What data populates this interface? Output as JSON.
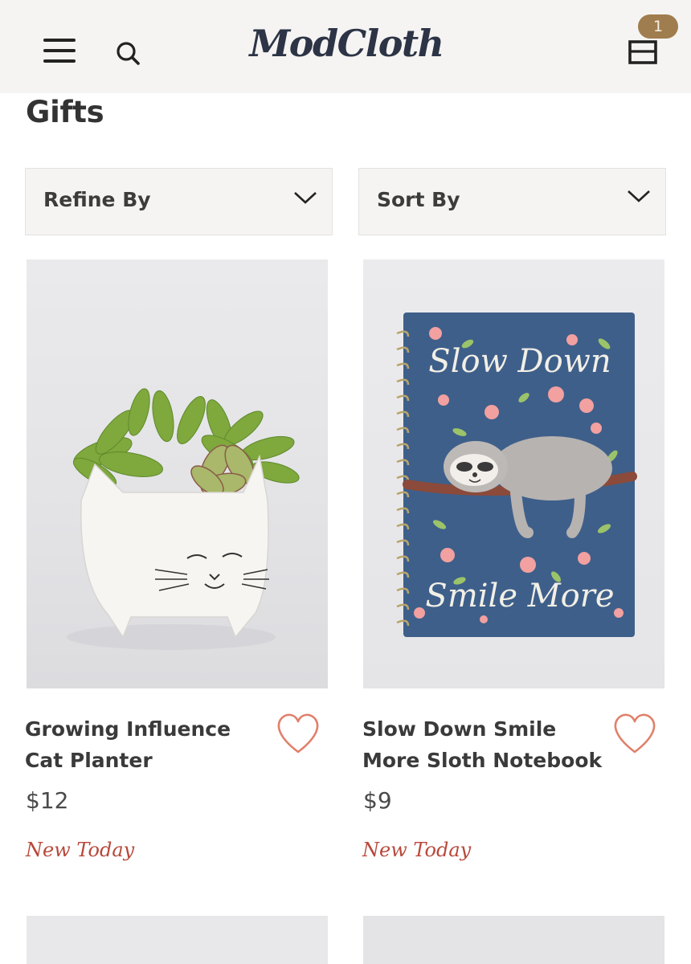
{
  "header": {
    "logo": "ModCloth",
    "cart_count": "1",
    "icons": {
      "menu": "hamburger-menu-icon",
      "search": "search-icon",
      "cart": "shopping-bag-icon"
    }
  },
  "page": {
    "title": "Gifts"
  },
  "filters": {
    "refine_label": "Refine By",
    "sort_label": "Sort By"
  },
  "products": [
    {
      "title": "Growing Influence Cat Planter",
      "price": "$12",
      "badge": "New Today",
      "image": "white cat planter with succulents"
    },
    {
      "title": "Slow Down Smile More Sloth Notebook",
      "price": "$9",
      "badge": "New Today",
      "image": "blue spiral notebook with sloth",
      "cover_text": [
        "Slow Down",
        "Smile More"
      ]
    }
  ],
  "colors": {
    "header_bg": "#f5f4f2",
    "logo": "#2c3446",
    "cart_badge": "#a07d4e",
    "heart": "#e0806a",
    "new_badge": "#b8483a",
    "notebook": "#3e5f8a"
  }
}
